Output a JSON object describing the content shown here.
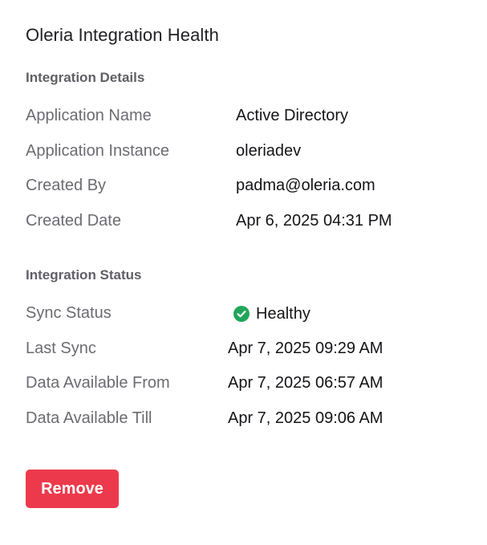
{
  "title": "Oleria Integration Health",
  "details": {
    "heading": "Integration Details",
    "rows": [
      {
        "label": "Application Name",
        "value": "Active Directory"
      },
      {
        "label": "Application Instance",
        "value": "oleriadev"
      },
      {
        "label": "Created By",
        "value": "padma@oleria.com"
      },
      {
        "label": "Created Date",
        "value": "Apr 6, 2025 04:31 PM"
      }
    ]
  },
  "status": {
    "heading": "Integration Status",
    "sync_status": {
      "label": "Sync Status",
      "value": "Healthy",
      "icon": "check-circle-icon",
      "color": "#22a55a"
    },
    "rows": [
      {
        "label": "Last Sync",
        "value": "Apr 7, 2025 09:29 AM"
      },
      {
        "label": "Data Available From",
        "value": "Apr 7, 2025 06:57 AM"
      },
      {
        "label": "Data Available Till",
        "value": "Apr 7, 2025 09:06 AM"
      }
    ]
  },
  "actions": {
    "remove_label": "Remove",
    "remove_color": "#ec3a4c"
  }
}
